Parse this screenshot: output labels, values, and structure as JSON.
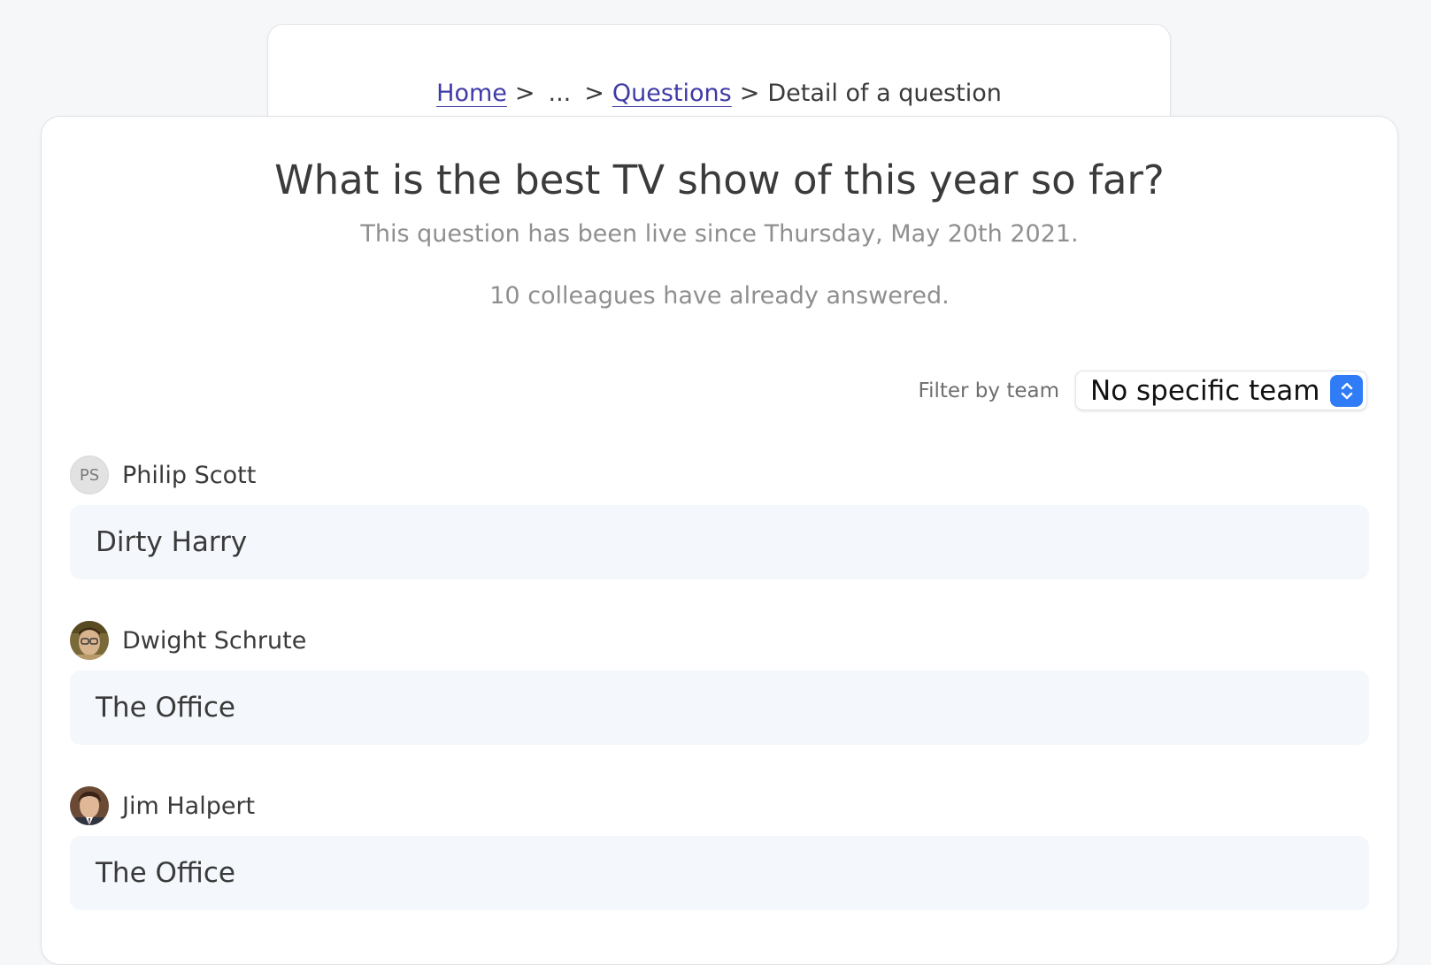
{
  "breadcrumb": {
    "home": "Home",
    "ellipsis": "...",
    "questions": "Questions",
    "current": "Detail of a question",
    "separator": ">"
  },
  "question": {
    "title": "What is the best TV show of this year so far?",
    "live_since": "This question has been live since Thursday, May 20th 2021.",
    "answer_count": "10 colleagues have already answered."
  },
  "filter": {
    "label": "Filter by team",
    "selected": "No specific team"
  },
  "answers": [
    {
      "author": "Philip Scott",
      "avatar_initials": "PS",
      "answer": "Dirty Harry"
    },
    {
      "author": "Dwight Schrute",
      "avatar_initials": "",
      "answer": "The Office"
    },
    {
      "author": "Jim Halpert",
      "avatar_initials": "",
      "answer": "The Office"
    }
  ],
  "colors": {
    "link": "#3f3ba6",
    "select_accent": "#2f7cf6",
    "answer_background": "#f4f7fb"
  },
  "icons": {
    "select_arrows": "chevron-up-down-icon"
  }
}
